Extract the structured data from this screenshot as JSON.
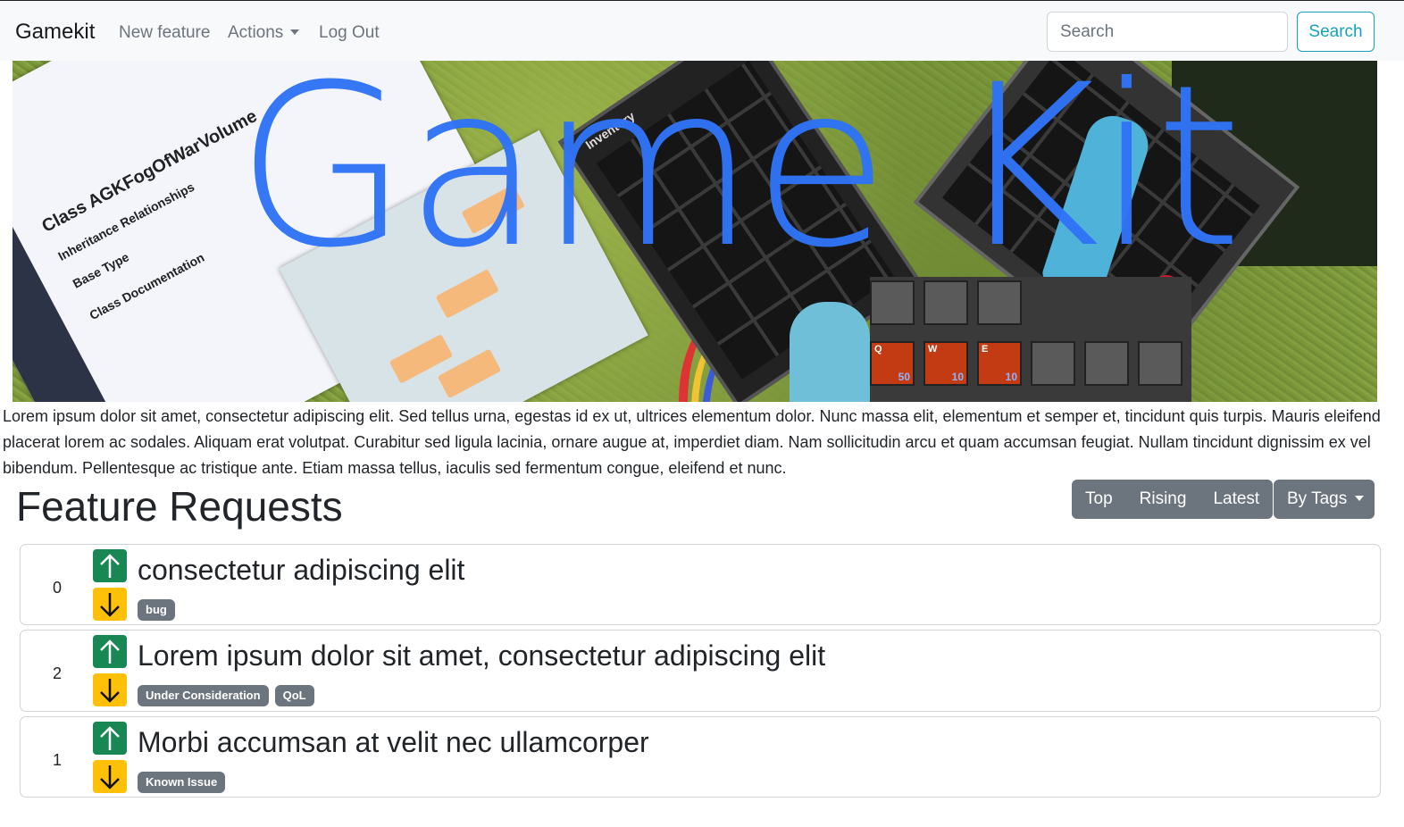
{
  "navbar": {
    "brand": "Gamekit",
    "links": [
      "New feature",
      "Actions",
      "Log Out"
    ],
    "search_placeholder": "Search",
    "search_button": "Search"
  },
  "banner": {
    "title": "Game Kit",
    "doc_snippets": [
      "Class AGKFogOfWarVolume",
      "Inheritance Relationships",
      "Base Type",
      "Class Documentation"
    ],
    "inventory_label": "Inventory",
    "hotbar": [
      {
        "key": "Q",
        "count": "50"
      },
      {
        "key": "W",
        "count": "10"
      },
      {
        "key": "E",
        "count": "10"
      }
    ]
  },
  "intro_text": "Lorem ipsum dolor sit amet, consectetur adipiscing elit. Sed tellus urna, egestas id ex ut, ultrices elementum dolor. Nunc massa elit, elementum et semper et, tincidunt quis turpis. Mauris eleifend placerat lorem ac sodales. Aliquam erat volutpat. Curabitur sed ligula lacinia, ornare augue at, imperdiet diam. Nam sollicitudin arcu et quam accumsan feugiat. Nullam tincidunt dignissim ex vel bibendum. Pellentesque ac tristique ante. Etiam massa tellus, iaculis sed fermentum congue, eleifend et nunc.",
  "features": {
    "heading": "Feature Requests",
    "sort_buttons": [
      "Top",
      "Rising",
      "Latest"
    ],
    "tags_button": "By Tags",
    "requests": [
      {
        "votes": "0",
        "title": "consectetur adipiscing elit",
        "tags": [
          "bug"
        ]
      },
      {
        "votes": "2",
        "title": "Lorem ipsum dolor sit amet, consectetur adipiscing elit",
        "tags": [
          "Under Consideration",
          "QoL"
        ]
      },
      {
        "votes": "1",
        "title": "Morbi accumsan at velit nec ullamcorper",
        "tags": [
          "Known Issue"
        ]
      }
    ]
  },
  "colors": {
    "upvote": "#198754",
    "downvote": "#ffc107",
    "badge": "#6c757d",
    "banner_title": "#2f73f5",
    "search_accent": "#17a2b8"
  }
}
